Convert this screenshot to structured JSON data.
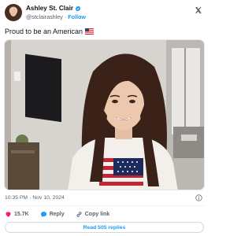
{
  "author": {
    "display_name": "Ashley St. Clair",
    "handle": "@stclairashley",
    "separator": "·",
    "follow_label": "Follow",
    "avatar_icon": "profile-photo",
    "verified_icon": "verified-badge-icon"
  },
  "tweet": {
    "text": "Proud to be an American",
    "emoji_icon": "us-flag-emoji"
  },
  "media": {
    "description_icon": "photo"
  },
  "meta": {
    "time": "10:35 PM",
    "separator": "·",
    "date": "Nov 10, 2024"
  },
  "actions": {
    "like_count": "15.7K",
    "reply_label": "Reply",
    "copy_link_label": "Copy link"
  },
  "footer": {
    "read_replies_label": "Read 505 replies"
  },
  "colors": {
    "accent": "#1d9bf0",
    "like": "#f91880",
    "text": "#0f1419",
    "muted": "#536471"
  }
}
